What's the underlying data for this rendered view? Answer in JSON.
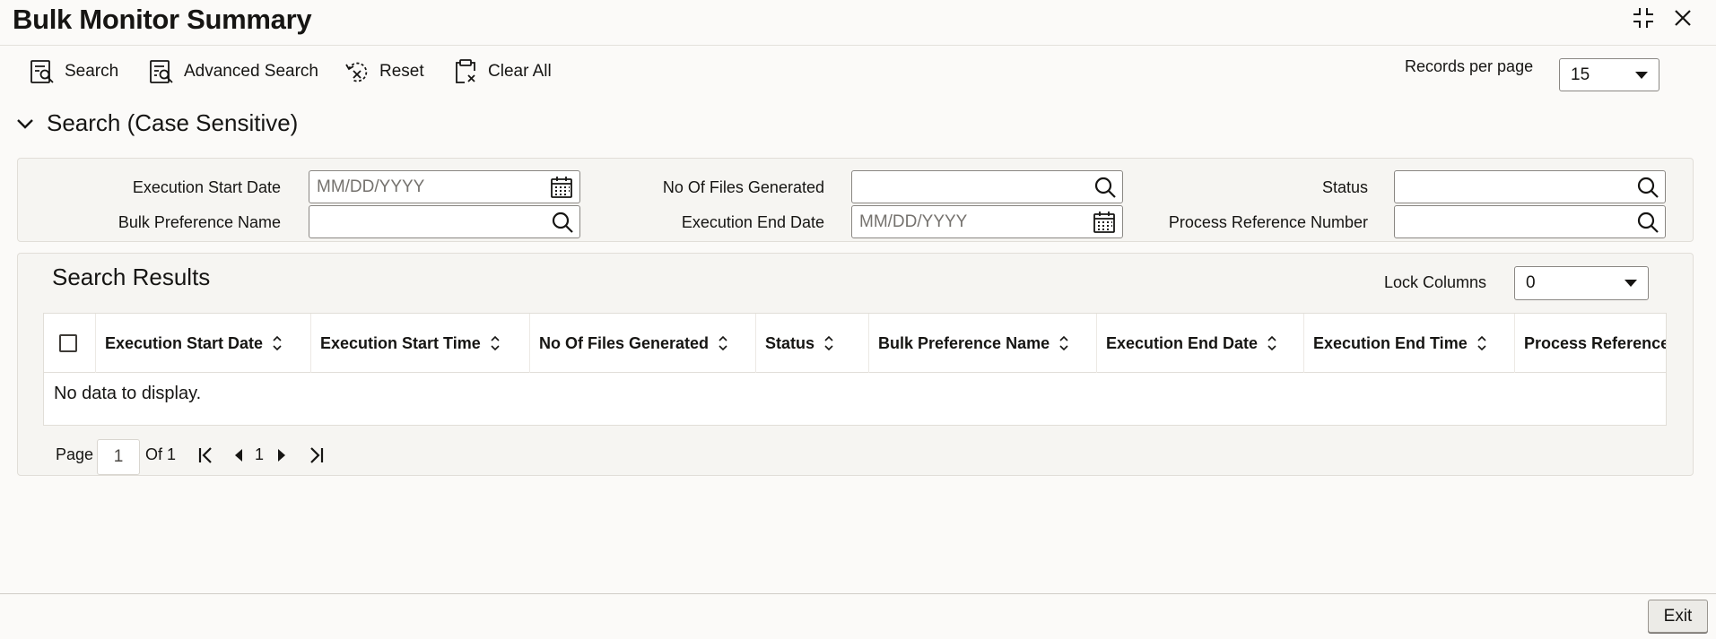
{
  "window": {
    "title": "Bulk Monitor Summary",
    "controls": [
      "collapse-icon",
      "close-icon"
    ]
  },
  "toolbar": {
    "search_label": "Search",
    "advanced_search_label": "Advanced Search",
    "reset_label": "Reset",
    "clear_all_label": "Clear All",
    "records_per_page_label": "Records per page",
    "records_per_page_value": "15"
  },
  "search_section": {
    "title": "Search (Case Sensitive)",
    "fields": {
      "execution_start_date": {
        "label": "Execution Start Date",
        "placeholder": "MM/DD/YYYY",
        "value": ""
      },
      "bulk_preference_name": {
        "label": "Bulk Preference Name",
        "value": ""
      },
      "no_of_files_generated": {
        "label": "No Of Files Generated",
        "value": ""
      },
      "execution_end_date": {
        "label": "Execution End Date",
        "placeholder": "MM/DD/YYYY",
        "value": ""
      },
      "status": {
        "label": "Status",
        "value": ""
      },
      "process_reference_number": {
        "label": "Process Reference Number",
        "value": ""
      }
    }
  },
  "results": {
    "title": "Search Results",
    "lock_columns_label": "Lock Columns",
    "lock_columns_value": "0",
    "columns": [
      "Execution Start Date",
      "Execution Start Time",
      "No Of Files Generated",
      "Status",
      "Bulk Preference Name",
      "Execution End Date",
      "Execution End Time",
      "Process Reference N"
    ],
    "rows": [],
    "empty_message": "No data to display."
  },
  "pagination": {
    "page_label": "Page",
    "page_value": "1",
    "of_label": "Of 1",
    "current_page": "1"
  },
  "footer": {
    "exit_label": "Exit"
  },
  "colors": {
    "background": "#fbfaf8",
    "panel": "#f6f5f2",
    "text": "#161513",
    "border": "#8a8783"
  }
}
